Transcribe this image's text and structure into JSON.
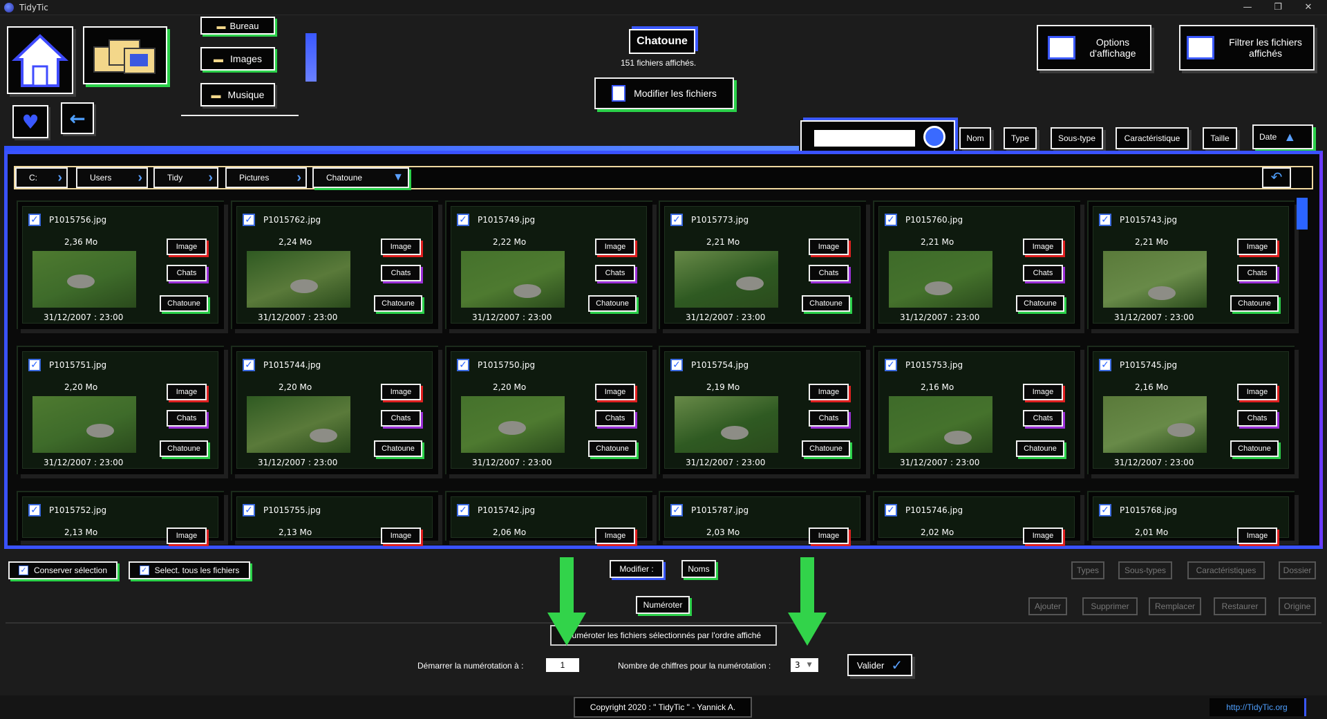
{
  "window": {
    "title": "TidyTic",
    "controls": [
      "—",
      "❐",
      "✕"
    ]
  },
  "top": {
    "folders": [
      {
        "label": "Bureau"
      },
      {
        "label": "Images"
      },
      {
        "label": "Musique"
      }
    ],
    "current_folder": "Chatoune",
    "files_count": "151 fichiers affichés.",
    "modify_button": "Modifier les fichiers",
    "display_options": "Options d'affichage",
    "filter_button": "Filtrer les fichiers affichés"
  },
  "sort": {
    "buttons": [
      "Nom",
      "Type",
      "Sous-type",
      "Caractéristique",
      "Taille",
      "Date"
    ],
    "search_value": ""
  },
  "breadcrumb": [
    "C:",
    "Users",
    "Tidy",
    "Pictures",
    "Chatoune"
  ],
  "files": [
    {
      "name": "P1015756.jpg",
      "size": "2,36 Mo",
      "date": "31/12/2007 : 23:00",
      "type": "Image",
      "subtype": "Chats",
      "tag": "Chatoune"
    },
    {
      "name": "P1015762.jpg",
      "size": "2,24 Mo",
      "date": "31/12/2007 : 23:00",
      "type": "Image",
      "subtype": "Chats",
      "tag": "Chatoune"
    },
    {
      "name": "P1015749.jpg",
      "size": "2,22 Mo",
      "date": "31/12/2007 : 23:00",
      "type": "Image",
      "subtype": "Chats",
      "tag": "Chatoune"
    },
    {
      "name": "P1015773.jpg",
      "size": "2,21 Mo",
      "date": "31/12/2007 : 23:00",
      "type": "Image",
      "subtype": "Chats",
      "tag": "Chatoune"
    },
    {
      "name": "P1015760.jpg",
      "size": "2,21 Mo",
      "date": "31/12/2007 : 23:00",
      "type": "Image",
      "subtype": "Chats",
      "tag": "Chatoune"
    },
    {
      "name": "P1015743.jpg",
      "size": "2,21 Mo",
      "date": "31/12/2007 : 23:00",
      "type": "Image",
      "subtype": "Chats",
      "tag": "Chatoune"
    },
    {
      "name": "P1015751.jpg",
      "size": "2,20 Mo",
      "date": "31/12/2007 : 23:00",
      "type": "Image",
      "subtype": "Chats",
      "tag": "Chatoune"
    },
    {
      "name": "P1015744.jpg",
      "size": "2,20 Mo",
      "date": "31/12/2007 : 23:00",
      "type": "Image",
      "subtype": "Chats",
      "tag": "Chatoune"
    },
    {
      "name": "P1015750.jpg",
      "size": "2,20 Mo",
      "date": "31/12/2007 : 23:00",
      "type": "Image",
      "subtype": "Chats",
      "tag": "Chatoune"
    },
    {
      "name": "P1015754.jpg",
      "size": "2,19 Mo",
      "date": "31/12/2007 : 23:00",
      "type": "Image",
      "subtype": "Chats",
      "tag": "Chatoune"
    },
    {
      "name": "P1015753.jpg",
      "size": "2,16 Mo",
      "date": "31/12/2007 : 23:00",
      "type": "Image",
      "subtype": "Chats",
      "tag": "Chatoune"
    },
    {
      "name": "P1015745.jpg",
      "size": "2,16 Mo",
      "date": "31/12/2007 : 23:00",
      "type": "Image",
      "subtype": "Chats",
      "tag": "Chatoune"
    },
    {
      "name": "P1015752.jpg",
      "size": "2,13 Mo",
      "type": "Image"
    },
    {
      "name": "P1015755.jpg",
      "size": "2,13 Mo",
      "type": "Image"
    },
    {
      "name": "P1015742.jpg",
      "size": "2,06 Mo",
      "type": "Image"
    },
    {
      "name": "P1015787.jpg",
      "size": "2,03 Mo",
      "type": "Image"
    },
    {
      "name": "P1015746.jpg",
      "size": "2,02 Mo",
      "type": "Image"
    },
    {
      "name": "P1015768.jpg",
      "size": "2,01 Mo",
      "type": "Image"
    }
  ],
  "bottom": {
    "keep_selection": "Conserver sélection",
    "select_all": "Select. tous les fichiers",
    "modify_label": "Modifier :",
    "names_button": "Noms",
    "number_button": "Numéroter",
    "right_row1": [
      "Types",
      "Sous-types",
      "Caractéristiques",
      "Dossier"
    ],
    "right_row2": [
      "Ajouter",
      "Supprimer",
      "Remplacer",
      "Restaurer",
      "Origine"
    ],
    "numbering_desc": "Numéroter les fichiers sélectionnés par l'ordre affiché",
    "start_label": "Démarrer la numérotation à :",
    "start_value": "1",
    "digits_label": "Nombre de chiffres pour la numérotation :",
    "digits_value": "3",
    "validate": "Valider"
  },
  "footer": {
    "copyright": "Copyright 2020 : \" TidyTic \" - Yannick A.",
    "link": "http://TidyTic.org"
  },
  "colors": {
    "accent_blue": "#2b64ff",
    "accent_green": "#2bd14a",
    "accent_red": "#e02020",
    "accent_purple": "#9b2fd8"
  }
}
